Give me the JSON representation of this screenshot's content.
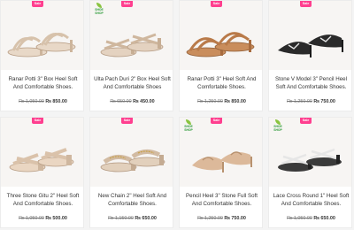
{
  "products": [
    {
      "name": "Ranar Potti 3\" Box Heel Soft And Comfortable Shoes.",
      "old_price": "₨ 1,050.00",
      "new_price": "₨ 850.00",
      "badge": "Sale",
      "logo": "",
      "color": "#e8d8c7",
      "icon": "strappy-heel-icon"
    },
    {
      "name": "Ulta Pach Duri 2\" Box Heel Soft And Comfortable Shoes",
      "old_price": "₨ 650.00",
      "new_price": "₨ 450.00",
      "badge": "Sale",
      "logo": "SHOE SHOP",
      "color": "#e4d2c0",
      "icon": "cross-strap-heel-icon"
    },
    {
      "name": "Ranar Potti 3\" Heel Soft And Comfortable Shoes.",
      "old_price": "₨ 1,250.00",
      "new_price": "₨ 850.00",
      "badge": "Sale",
      "logo": "",
      "color": "#c98d5c",
      "icon": "strappy-heel-icon"
    },
    {
      "name": "Stone V Model 3\" Pencil Heel Soft And Comfortable Shoes.",
      "old_price": "₨ 1,250.00",
      "new_price": "₨ 750.00",
      "badge": "Sale",
      "logo": "",
      "color": "#2a2a2a",
      "icon": "pointed-heel-icon"
    },
    {
      "name": "Three Stone Gitu 2\" Heel Soft And Comfortable Shoes.",
      "old_price": "₨ 1,050.00",
      "new_price": "₨ 500.00",
      "badge": "Sale",
      "logo": "",
      "color": "#ead6c2",
      "icon": "block-heel-icon"
    },
    {
      "name": "New Chain 2\" Heel Soft And Comfortable Shoes.",
      "old_price": "₨ 1,150.00",
      "new_price": "₨ 650.00",
      "badge": "Sale",
      "logo": "",
      "color": "#e2d0bc",
      "icon": "chain-heel-icon"
    },
    {
      "name": "Pencil Heel 3\" Stone Full Soft And Comfortable Shoes.",
      "old_price": "₨ 1,250.00",
      "new_price": "₨ 750.00",
      "badge": "Sale",
      "logo": "SHOE SHOP",
      "color": "#dcb99a",
      "icon": "slingback-heel-icon"
    },
    {
      "name": "Lace Cross Round 1\" Heel Soft And Comfortable Shoes.",
      "old_price": "₨ 1,050.00",
      "new_price": "₨ 650.00",
      "badge": "Sale",
      "logo": "SHOE SHOP",
      "color": "#3a3a3a",
      "icon": "lace-cross-heel-icon"
    }
  ]
}
